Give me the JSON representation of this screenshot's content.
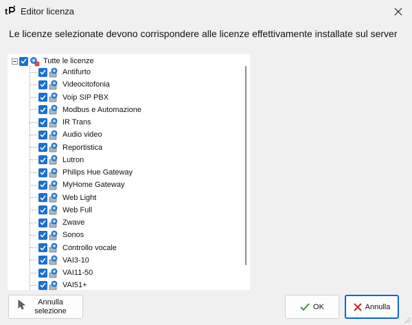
{
  "window": {
    "title": "Editor licenza"
  },
  "message": "Le licenze selezionate devono corrispondere alle licenze effettivamente installate sul server",
  "tree": {
    "root": {
      "label": "Tutte le licenze",
      "checked": true,
      "expanded": true
    },
    "items": [
      {
        "label": "Antifurto",
        "checked": true
      },
      {
        "label": "Videocitofonia",
        "checked": true
      },
      {
        "label": "Voip SIP PBX",
        "checked": true
      },
      {
        "label": "Modbus e Automazione",
        "checked": true
      },
      {
        "label": "IR Trans",
        "checked": true
      },
      {
        "label": "Audio video",
        "checked": true
      },
      {
        "label": "Reportistica",
        "checked": true
      },
      {
        "label": "Lutron",
        "checked": true
      },
      {
        "label": "Philips Hue Gateway",
        "checked": true
      },
      {
        "label": "MyHome Gateway",
        "checked": true
      },
      {
        "label": "Web Light",
        "checked": true
      },
      {
        "label": "Web Full",
        "checked": true
      },
      {
        "label": "Zwave",
        "checked": true
      },
      {
        "label": "Sonos",
        "checked": true
      },
      {
        "label": "Controllo vocale",
        "checked": true
      },
      {
        "label": "VAI3-10",
        "checked": true
      },
      {
        "label": "VAI11-50",
        "checked": true
      },
      {
        "label": "VAI51+",
        "checked": true
      }
    ]
  },
  "buttons": {
    "deselect_line1": "Annulla",
    "deselect_line2": "selezione",
    "ok": "OK",
    "cancel": "Annulla"
  },
  "colors": {
    "checkbox": "#1a6fd1",
    "ok_icon": "#2e9a3a",
    "cancel_icon": "#d01e1e",
    "cancel_border": "#0a64d8"
  },
  "icons": [
    "app-logo-icon",
    "close-icon",
    "license-icon",
    "cursor-icon",
    "check-icon",
    "x-icon",
    "resize-grip-icon"
  ]
}
